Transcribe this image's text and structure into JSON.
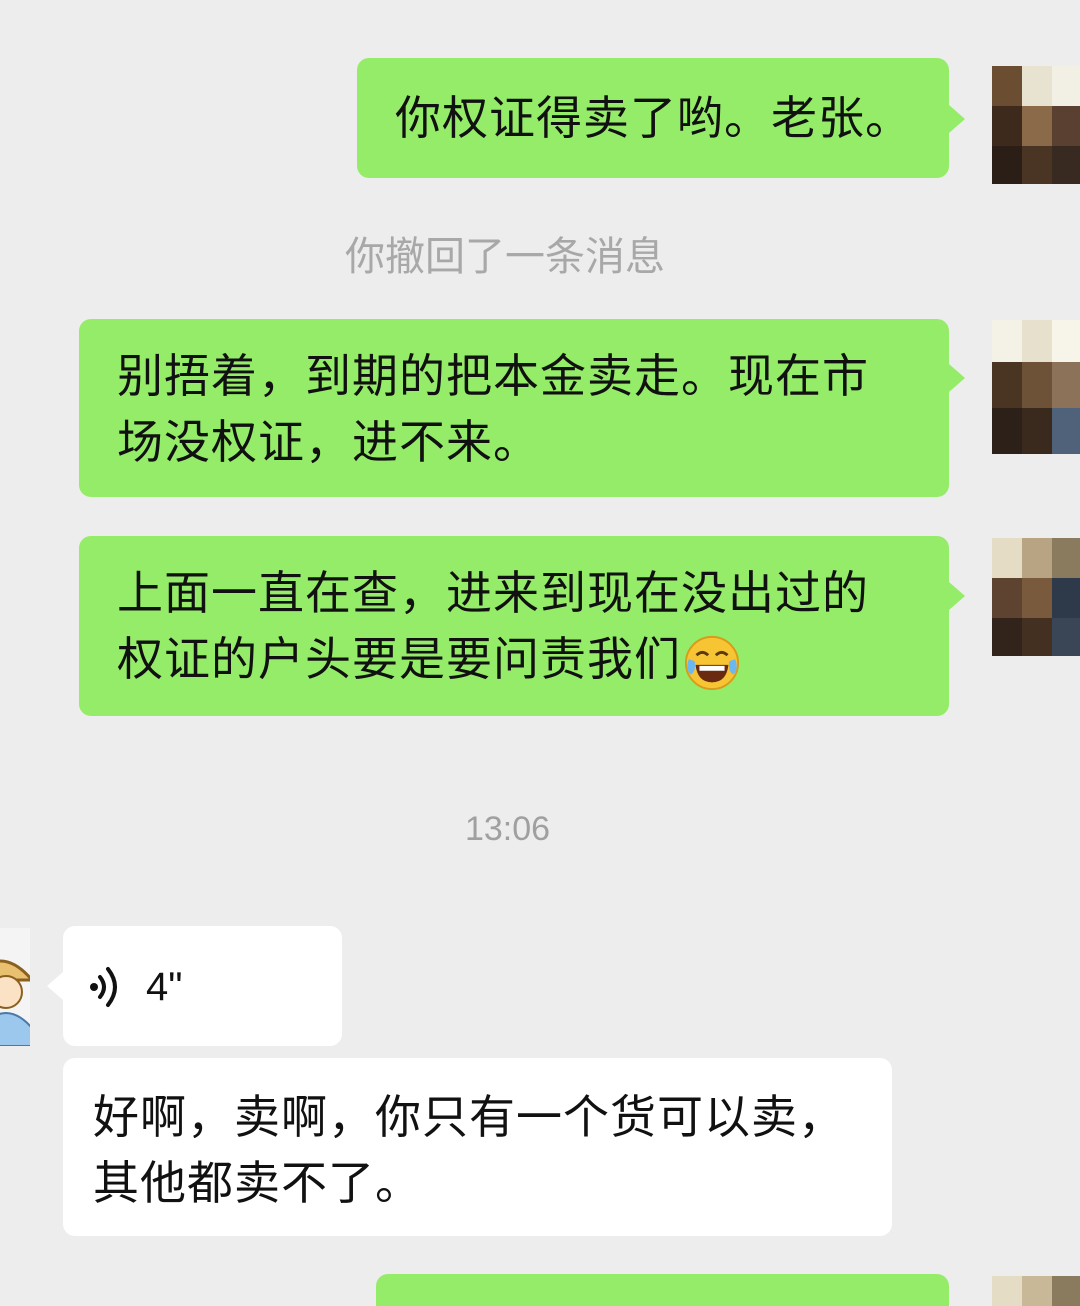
{
  "messages": [
    {
      "id": "m1",
      "text": "你权证得卖了哟。老张。"
    },
    {
      "id": "m2",
      "text": "你撤回了一条消息"
    },
    {
      "id": "m3",
      "line1": "别捂着，到期的把本金卖走。现在市",
      "line2": "场没权证，进不来。"
    },
    {
      "id": "m4",
      "line1": "上面一直在查，进来到现在没出过的",
      "line2": "权证的户头要是要问责我们"
    },
    {
      "id": "time",
      "text": "13:06"
    },
    {
      "id": "m5",
      "voice_duration": "4\""
    },
    {
      "id": "m6",
      "line1": "好啊，卖啊，你只有一个货可以卖，",
      "line2": "其他都卖不了。"
    }
  ],
  "icons": {
    "voice": "voice-wave-icon",
    "emoji": "tears-of-joy-emoji"
  },
  "colors": {
    "background": "#ededed",
    "outgoing_bubble": "#95ec69",
    "incoming_bubble": "#ffffff",
    "system_text": "#a8a8a8"
  }
}
